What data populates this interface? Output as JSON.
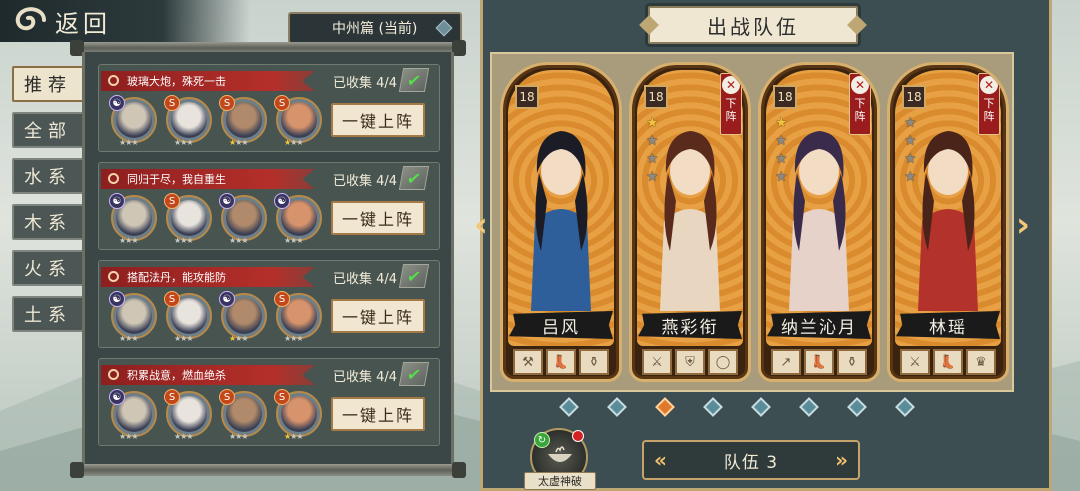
{
  "header": {
    "back_label": "返回",
    "chapter_label": "中州篇 (当前)"
  },
  "filters": [
    "推荐",
    "全部",
    "水系",
    "木系",
    "火系",
    "土系"
  ],
  "combos": [
    {
      "title": "玻璃大炮，殊死一击",
      "collected": "已收集 4/4",
      "deploy_label": "一键上阵",
      "heroes": [
        {
          "element": "yin",
          "stars": 3,
          "gold": 0
        },
        {
          "element": "fire",
          "stars": 3,
          "gold": 0
        },
        {
          "element": "fire",
          "stars": 3,
          "gold": 1
        },
        {
          "element": "fire",
          "stars": 3,
          "gold": 1
        }
      ]
    },
    {
      "title": "同归于尽，我自重生",
      "collected": "已收集 4/4",
      "deploy_label": "一键上阵",
      "heroes": [
        {
          "element": "yin",
          "stars": 3,
          "gold": 0
        },
        {
          "element": "fire",
          "stars": 3,
          "gold": 0
        },
        {
          "element": "yin",
          "stars": 3,
          "gold": 0
        },
        {
          "element": "yin",
          "stars": 3,
          "gold": 0
        }
      ]
    },
    {
      "title": "搭配法丹，能攻能防",
      "collected": "已收集 4/4",
      "deploy_label": "一键上阵",
      "heroes": [
        {
          "element": "yin",
          "stars": 3,
          "gold": 0
        },
        {
          "element": "fire",
          "stars": 3,
          "gold": 0
        },
        {
          "element": "yin",
          "stars": 3,
          "gold": 1
        },
        {
          "element": "fire",
          "stars": 3,
          "gold": 0
        }
      ]
    },
    {
      "title": "积累战意，燃血绝杀",
      "collected": "已收集 4/4",
      "deploy_label": "一键上阵",
      "heroes": [
        {
          "element": "yin",
          "stars": 3,
          "gold": 0
        },
        {
          "element": "fire",
          "stars": 3,
          "gold": 0
        },
        {
          "element": "fire",
          "stars": 3,
          "gold": 0
        },
        {
          "element": "fire",
          "stars": 3,
          "gold": 1
        }
      ]
    }
  ],
  "team": {
    "title": "出战队伍",
    "cards": [
      {
        "name": "吕风",
        "level": "18",
        "stars": 0,
        "gold": 0,
        "removable": false,
        "equips": [
          "axe-icon",
          "boots-icon",
          "flask-icon"
        ]
      },
      {
        "name": "燕彩衔",
        "level": "18",
        "stars": 4,
        "gold": 1,
        "removable": true,
        "remove_label": "下阵",
        "equips": [
          "sword-icon",
          "armor-icon",
          "ring-icon"
        ]
      },
      {
        "name": "纳兰沁月",
        "level": "18",
        "stars": 4,
        "gold": 1,
        "removable": true,
        "remove_label": "下阵",
        "equips": [
          "spear-icon",
          "boots-icon",
          "flask-icon"
        ]
      },
      {
        "name": "林瑶",
        "level": "18",
        "stars": 4,
        "gold": 0,
        "removable": true,
        "remove_label": "下阵",
        "equips": [
          "sword-icon",
          "boots-icon",
          "crown-icon"
        ]
      }
    ],
    "page_count": 8,
    "active_page": 2,
    "team_label": "队伍 3"
  },
  "skill": {
    "label": "太虚神破"
  },
  "colors": {
    "accent_gold": "#d7b06d",
    "banner_red": "#b52f2a",
    "check_green": "#55e04a",
    "active_dot": "#e07a2a"
  }
}
